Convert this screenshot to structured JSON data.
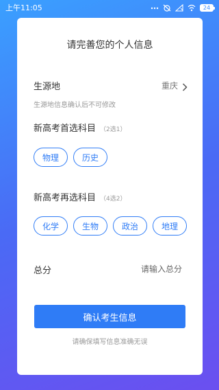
{
  "status_bar": {
    "time": "上午11:05",
    "battery": "24"
  },
  "card": {
    "title": "请完善您的个人信息",
    "origin": {
      "label": "生源地",
      "value": "重庆",
      "hint": "生源地信息确认后不可修改"
    },
    "first_subject": {
      "title": "新高考首选科目",
      "rule": "（2选1）",
      "options": [
        "物理",
        "历史"
      ]
    },
    "second_subject": {
      "title": "新高考再选科目",
      "rule": "（4选2）",
      "options": [
        "化学",
        "生物",
        "政治",
        "地理"
      ]
    },
    "total": {
      "label": "总分",
      "placeholder": "请输入总分"
    },
    "confirm_label": "确认考生信息",
    "footer_note": "请确保填写信息准确无误"
  }
}
